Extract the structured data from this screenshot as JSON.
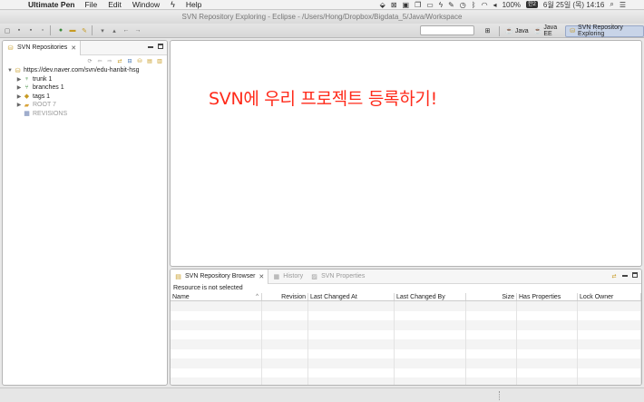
{
  "menubar": {
    "app_name": "Ultimate Pen",
    "menus": [
      "File",
      "Edit",
      "Window"
    ],
    "help": "Help",
    "battery": "100%",
    "battery_badge": "한2",
    "datetime": "6월 25일 (목)  14:16"
  },
  "window": {
    "title": "SVN Repository Exploring - Eclipse - /Users/Hong/Dropbox/Bigdata_5/Java/Workspace"
  },
  "perspectives": [
    "Java",
    "Java EE",
    "SVN Repository Exploring"
  ],
  "left_view": {
    "tab_label": "SVN Repositories",
    "tree": [
      {
        "label": "https://dev.naver.com/svn/edu-hanbit-hsg",
        "level": 0,
        "icon": "repository-icon",
        "expanded": true
      },
      {
        "label": "trunk 1",
        "level": 1,
        "icon": "trunk-icon"
      },
      {
        "label": "branches 1",
        "level": 1,
        "icon": "branches-icon"
      },
      {
        "label": "tags 1",
        "level": 1,
        "icon": "tags-icon"
      },
      {
        "label": "ROOT 7",
        "level": 1,
        "icon": "folder-icon",
        "dim": true
      },
      {
        "label": "REVISIONS",
        "level": 1,
        "icon": "revisions-icon",
        "dim": true,
        "leaf": true
      }
    ]
  },
  "editor": {
    "annotation": "SVN에 우리 프로젝트 등록하기!",
    "annotation_color": "#ff2a1a"
  },
  "bottom_view": {
    "tabs": [
      "SVN Repository Browser",
      "History",
      "SVN Properties"
    ],
    "status": "Resource is not selected",
    "columns": [
      "Name",
      "Revision",
      "Last Changed At",
      "Last Changed By",
      "Size",
      "Has Properties",
      "Lock Owner"
    ]
  }
}
